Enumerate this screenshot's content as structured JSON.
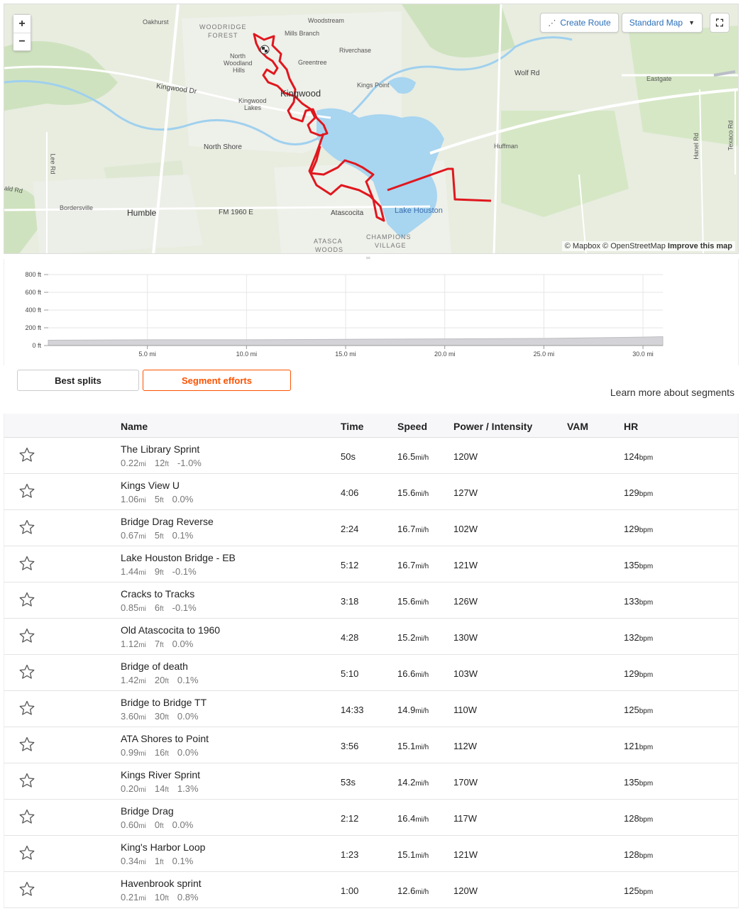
{
  "map": {
    "zoom_in": "+",
    "zoom_out": "−",
    "create_route": "Create Route",
    "map_style": "Standard Map",
    "attribution_mapbox": "© Mapbox",
    "attribution_osm": "© OpenStreetMap",
    "attribution_improve": "Improve this map",
    "labels": [
      {
        "text": "Oakhurst"
      },
      {
        "text": "WOODRIDGE"
      },
      {
        "text": "FOREST"
      },
      {
        "text": "Mills Branch"
      },
      {
        "text": "Woodstream"
      },
      {
        "text": "Riverchase"
      },
      {
        "text": "North"
      },
      {
        "text": "Woodland"
      },
      {
        "text": "Hills"
      },
      {
        "text": "Greentree"
      },
      {
        "text": "Kingwood"
      },
      {
        "text": "Kings Point"
      },
      {
        "text": "Wolf Rd"
      },
      {
        "text": "Eastgate"
      },
      {
        "text": "Kingwood Dr"
      },
      {
        "text": "Kingwood"
      },
      {
        "text": "Lakes"
      },
      {
        "text": "North Shore"
      },
      {
        "text": "Huffman"
      },
      {
        "text": "Lee Rd"
      },
      {
        "text": "ald Rd"
      },
      {
        "text": "Bordersville"
      },
      {
        "text": "Humble"
      },
      {
        "text": "FM 1960 E"
      },
      {
        "text": "Atascocita"
      },
      {
        "text": "Lake Houston"
      },
      {
        "text": "CHAMPIONS"
      },
      {
        "text": "VILLAGE"
      },
      {
        "text": "ATASCA"
      },
      {
        "text": "WOODS"
      },
      {
        "text": "Hanel Rd"
      },
      {
        "text": "Texaco Rd"
      }
    ]
  },
  "elevation": {
    "y_ticks": [
      "800 ft",
      "600 ft",
      "400 ft",
      "200 ft",
      "0 ft"
    ],
    "x_ticks": [
      "5.0 mi",
      "10.0 mi",
      "15.0 mi",
      "20.0 mi",
      "25.0 mi",
      "30.0 mi"
    ]
  },
  "chart_data": {
    "type": "area",
    "x": [
      0,
      5,
      10,
      15,
      20,
      25,
      30,
      31
    ],
    "y": [
      60,
      65,
      65,
      70,
      75,
      80,
      95,
      100
    ],
    "xlabel": "",
    "ylabel": "",
    "ylim": [
      0,
      800
    ],
    "xlim": [
      0,
      31
    ],
    "grid": true
  },
  "tabs": {
    "best": "Best splits",
    "segments": "Segment efforts",
    "learn_more": "Learn more about segments"
  },
  "table": {
    "headers": {
      "name": "Name",
      "time": "Time",
      "speed": "Speed",
      "power": "Power / Intensity",
      "vam": "VAM",
      "hr": "HR"
    },
    "units": {
      "dist": "mi",
      "elev": "ft",
      "speed": "mi/h",
      "power": "W",
      "hr": "bpm"
    },
    "rows": [
      {
        "name": "The Library Sprint",
        "dist": "0.22",
        "elev": "12",
        "grade": "-1.0%",
        "time": "50s",
        "speed": "16.5",
        "power": "120",
        "hr": "124"
      },
      {
        "name": "Kings View U",
        "dist": "1.06",
        "elev": "5",
        "grade": "0.0%",
        "time": "4:06",
        "speed": "15.6",
        "power": "127",
        "hr": "129"
      },
      {
        "name": "Bridge Drag Reverse",
        "dist": "0.67",
        "elev": "5",
        "grade": "0.1%",
        "time": "2:24",
        "speed": "16.7",
        "power": "102",
        "hr": "129"
      },
      {
        "name": "Lake Houston Bridge - EB",
        "dist": "1.44",
        "elev": "9",
        "grade": "-0.1%",
        "time": "5:12",
        "speed": "16.7",
        "power": "121",
        "hr": "135"
      },
      {
        "name": "Cracks to Tracks",
        "dist": "0.85",
        "elev": "6",
        "grade": "-0.1%",
        "time": "3:18",
        "speed": "15.6",
        "power": "126",
        "hr": "133"
      },
      {
        "name": "Old Atascocita to 1960",
        "dist": "1.12",
        "elev": "7",
        "grade": "0.0%",
        "time": "4:28",
        "speed": "15.2",
        "power": "130",
        "hr": "132"
      },
      {
        "name": "Bridge of death",
        "dist": "1.42",
        "elev": "20",
        "grade": "0.1%",
        "time": "5:10",
        "speed": "16.6",
        "power": "103",
        "hr": "129"
      },
      {
        "name": "Bridge to Bridge TT",
        "dist": "3.60",
        "elev": "30",
        "grade": "0.0%",
        "time": "14:33",
        "speed": "14.9",
        "power": "110",
        "hr": "125"
      },
      {
        "name": "ATA Shores to Point",
        "dist": "0.99",
        "elev": "16",
        "grade": "0.0%",
        "time": "3:56",
        "speed": "15.1",
        "power": "112",
        "hr": "121"
      },
      {
        "name": "Kings River Sprint",
        "dist": "0.20",
        "elev": "14",
        "grade": "1.3%",
        "time": "53s",
        "speed": "14.2",
        "power": "170",
        "hr": "135"
      },
      {
        "name": "Bridge Drag",
        "dist": "0.60",
        "elev": "0",
        "grade": "0.0%",
        "time": "2:12",
        "speed": "16.4",
        "power": "117",
        "hr": "128"
      },
      {
        "name": "King's Harbor Loop",
        "dist": "0.34",
        "elev": "1",
        "grade": "0.1%",
        "time": "1:23",
        "speed": "15.1",
        "power": "121",
        "hr": "128"
      },
      {
        "name": "Havenbrook sprint",
        "dist": "0.21",
        "elev": "10",
        "grade": "0.8%",
        "time": "1:00",
        "speed": "12.6",
        "power": "120",
        "hr": "125"
      }
    ]
  }
}
